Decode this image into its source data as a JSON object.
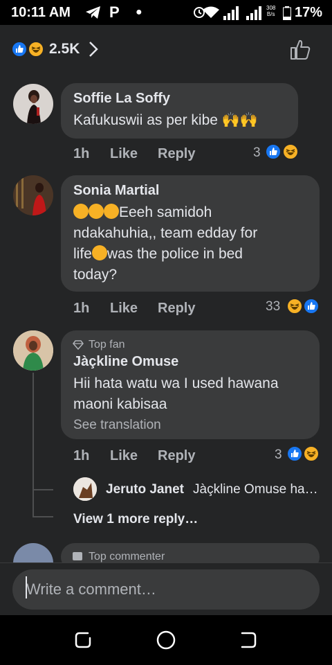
{
  "status_bar": {
    "time": "10:11 AM",
    "carrier_glyph": "P",
    "net_speed_value": "308",
    "net_speed_unit": "B/s",
    "battery": "17%"
  },
  "reactions": {
    "total": "2.5K",
    "icons": [
      "like-icon",
      "haha-icon"
    ]
  },
  "comments": [
    {
      "author": "Soffie La Soffy",
      "text": "Kafukuswii as per kibe 🙌🙌",
      "time": "1h",
      "like_label": "Like",
      "reply_label": "Reply",
      "reaction_count": "3"
    },
    {
      "author": "Sonia Martial",
      "line1": "Eeeh samidoh",
      "line2": "ndakahuhia,, team edday for",
      "line3a": "life",
      "line3b": "was the police in bed",
      "line4": "today?",
      "time": "1h",
      "like_label": "Like",
      "reply_label": "Reply",
      "reaction_count": "33"
    },
    {
      "badge": "Top fan",
      "author": "Jàçkline Omuse",
      "text": "Hii hata watu wa I used hawana maoni kabisaa",
      "see_translation": "See translation",
      "time": "1h",
      "like_label": "Like",
      "reply_label": "Reply",
      "reaction_count": "3"
    }
  ],
  "reply_preview": {
    "author": "Jeruto Janet",
    "text": "Jàçkline Omuse ha…"
  },
  "view_more_replies": "View 1 more reply…",
  "next_comment_badge": "Top commenter",
  "composer": {
    "placeholder": "Write a comment…"
  },
  "colors": {
    "background": "#242526",
    "bubble": "#3a3b3c",
    "like_blue": "#1877f2",
    "haha_yellow": "#f7b125"
  }
}
